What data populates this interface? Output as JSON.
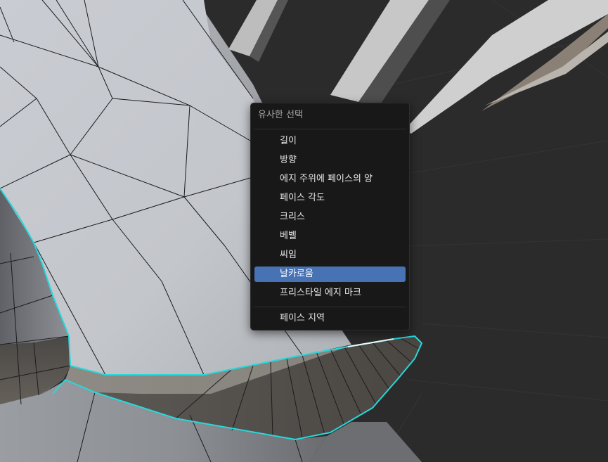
{
  "menu": {
    "title": "유사한 선택",
    "items": [
      {
        "label": "길이"
      },
      {
        "label": "방향"
      },
      {
        "label": "에지 주위에 페이스의 양"
      },
      {
        "label": "페이스 각도"
      },
      {
        "label": "크리스"
      },
      {
        "label": "베벨"
      },
      {
        "label": "씨임"
      },
      {
        "label": "날카로움",
        "highlighted": true
      },
      {
        "label": "프리스타일 에지 마크"
      }
    ],
    "footer_item": {
      "label": "페이스 지역"
    }
  },
  "colors": {
    "highlight": "#4772b3",
    "menu_bg": "#181818",
    "selected_edge": "#27d8dc",
    "viewport_bg": "#2b2b2b"
  }
}
